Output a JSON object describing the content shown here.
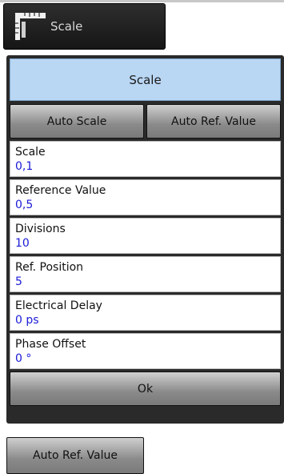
{
  "tile": {
    "label": "Scale",
    "icon": "ruler-icon"
  },
  "dialog": {
    "title": "Scale",
    "buttons": {
      "auto_scale": "Auto Scale",
      "auto_ref_value": "Auto Ref. Value"
    },
    "fields": [
      {
        "label": "Scale",
        "value": "0,1"
      },
      {
        "label": "Reference Value",
        "value": "0,5"
      },
      {
        "label": "Divisions",
        "value": "10"
      },
      {
        "label": "Ref. Position",
        "value": "5"
      },
      {
        "label": "Electrical Delay",
        "value": "0 ps"
      },
      {
        "label": "Phase Offset",
        "value": "0 °"
      }
    ],
    "ok_label": "Ok"
  },
  "standalone_button": {
    "label": "Auto Ref. Value"
  },
  "colors": {
    "title_bar": "#b9d6f3",
    "value_text": "#1a1ad8",
    "panel_bg": "#2a2a2a"
  }
}
